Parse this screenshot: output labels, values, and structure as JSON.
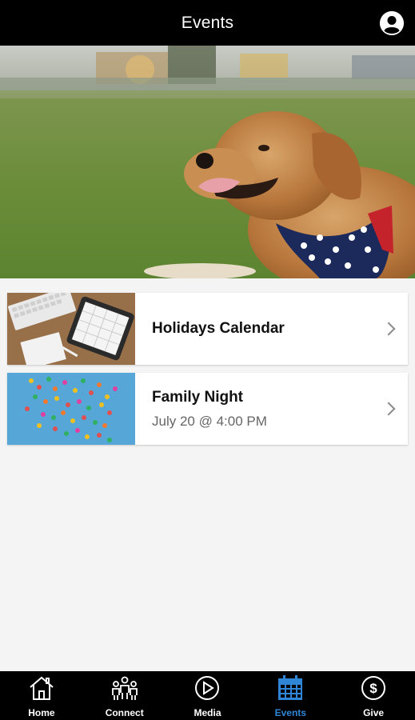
{
  "header": {
    "title": "Events"
  },
  "hero": {
    "image": "golden-retriever-with-flag-bandana-photo"
  },
  "events": [
    {
      "title": "Holidays Calendar",
      "subtitle": "",
      "thumbnail": "tablet-keyboard-desk-photo"
    },
    {
      "title": "Family Night",
      "subtitle": "July 20 @ 4:00 PM",
      "thumbnail": "colorful-confetti-photo"
    }
  ],
  "tabbar": {
    "items": [
      {
        "label": "Home",
        "icon": "home-icon",
        "active": false
      },
      {
        "label": "Connect",
        "icon": "people-icon",
        "active": false
      },
      {
        "label": "Media",
        "icon": "play-icon",
        "active": false
      },
      {
        "label": "Events",
        "icon": "calendar-icon",
        "active": true
      },
      {
        "label": "Give",
        "icon": "dollar-icon",
        "active": false
      }
    ]
  },
  "colors": {
    "header_bg": "#000000",
    "tab_active": "#2f86d6",
    "page_bg": "#f4f4f4"
  }
}
